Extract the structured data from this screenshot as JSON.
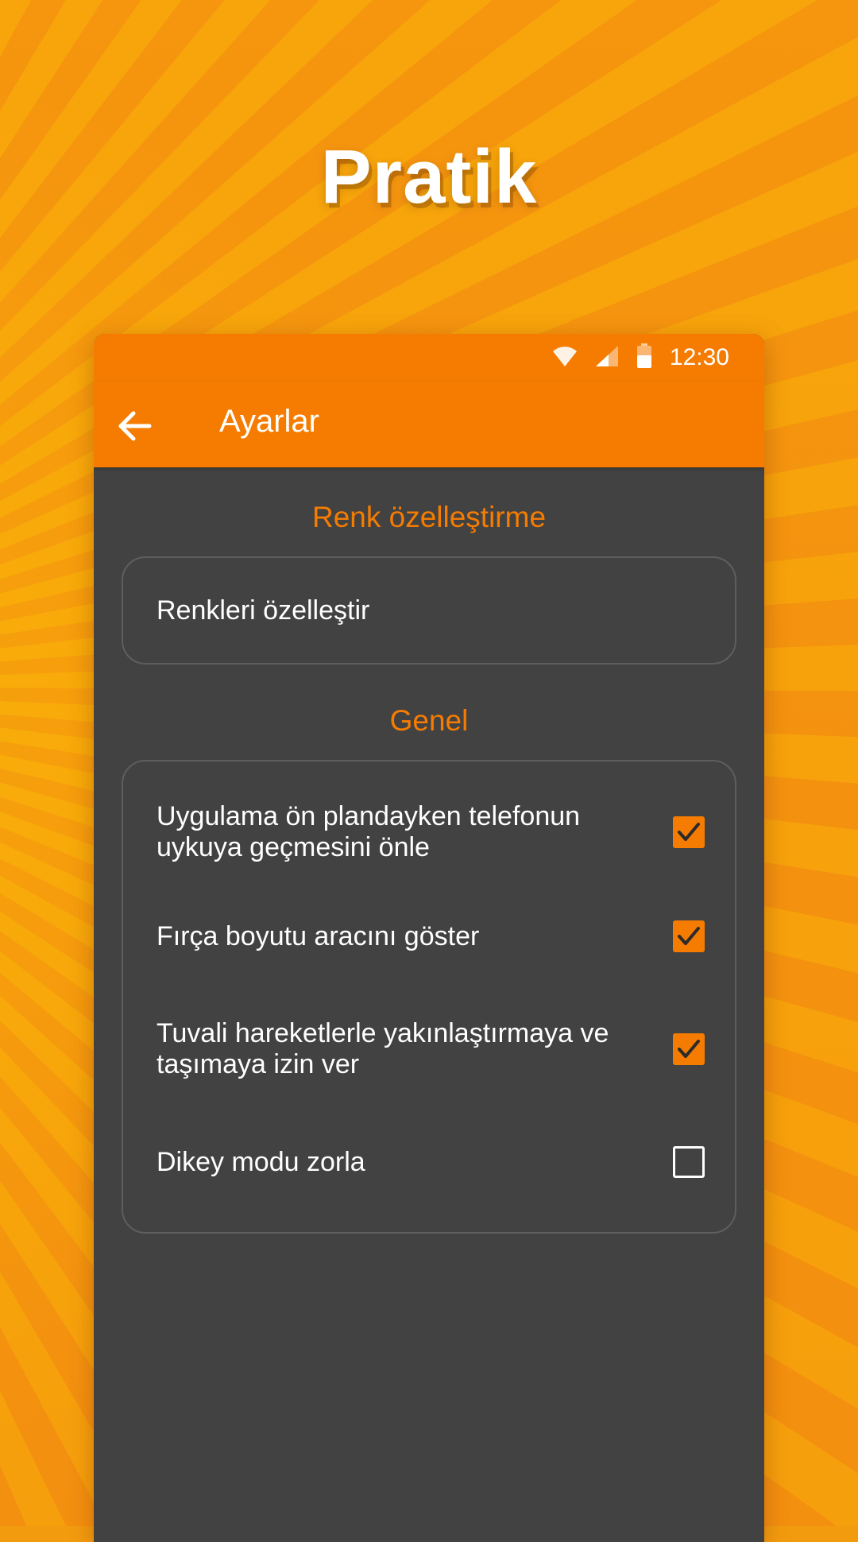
{
  "promo": {
    "headline": "Pratik"
  },
  "status_bar": {
    "time": "12:30",
    "icons": [
      "wifi-icon",
      "signal-icon",
      "battery-icon"
    ]
  },
  "app_bar": {
    "back_icon": "arrow-back-icon",
    "title": "Ayarlar"
  },
  "sections": {
    "color": {
      "title": "Renk özelleştirme",
      "item_label": "Renkleri özelleştir"
    },
    "general": {
      "title": "Genel",
      "items": [
        {
          "label": "Uygulama ön plandayken telefonun uykuya geçmesini önle",
          "checked": true
        },
        {
          "label": "Fırça boyutu aracını göster",
          "checked": true
        },
        {
          "label": "Tuvali hareketlerle yakınlaştırmaya ve taşımaya izin ver",
          "checked": true
        },
        {
          "label": "Dikey modu zorla",
          "checked": false
        }
      ]
    }
  },
  "colors": {
    "accent": "#f57c00",
    "surface": "#424242",
    "border": "#5e5e5e",
    "text": "#ffffff"
  }
}
